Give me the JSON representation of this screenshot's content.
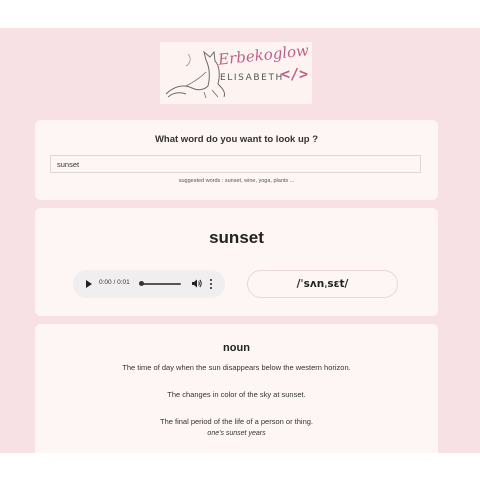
{
  "logo": {
    "script_text": "Erbekoglow",
    "name_text": "ELISABETH",
    "code_text": "</>"
  },
  "search": {
    "question": "What word do you want to look up ?",
    "value": "sunset",
    "suggestions": "suggested words : sunset, wine, yoga, plants ..."
  },
  "word": {
    "title": "sunset",
    "audio_time": "0:00 / 0:01",
    "phonetic": "/ˈsʌnˌsɛt/"
  },
  "meaning": {
    "part_of_speech": "noun",
    "definitions": [
      "The time of day when the sun disappears below the western horizon.",
      "The changes in color of the sky at sunset.",
      "The final period of the life of a person or thing."
    ],
    "example": "one's sunset years"
  },
  "colors": {
    "page_bg": "#f8e1e4",
    "card_bg": "#fdf6f4",
    "accent": "#c0608a"
  }
}
